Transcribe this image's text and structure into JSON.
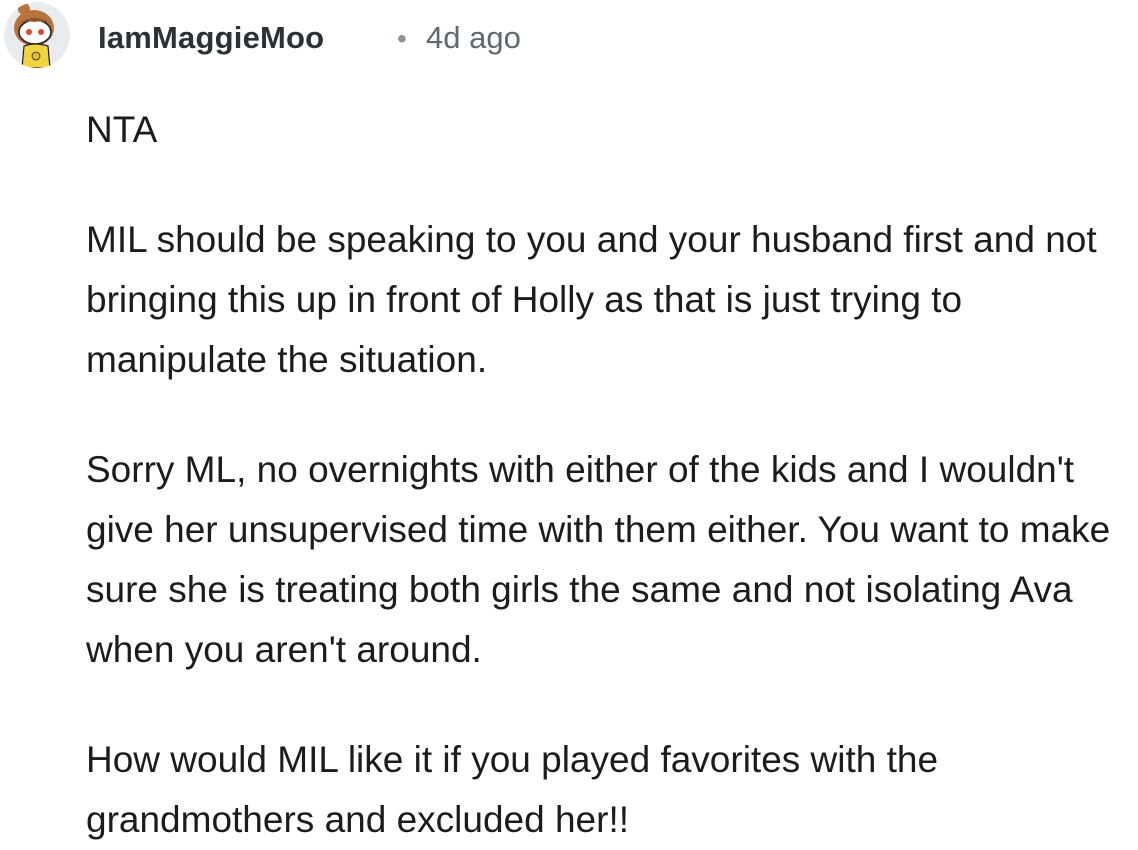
{
  "comment": {
    "author": "IamMaggieMoo",
    "separator": "•",
    "timestamp": "4d ago",
    "avatar_icon": "reddit-snoo-avatar-icon",
    "paragraphs": [
      "NTA",
      "MIL should be speaking to you and your husband first and not bringing this up in front of Holly as that is just trying to manipulate the situation.",
      "Sorry ML, no overnights with either of the kids and I wouldn't give her unsupervised time with them either. You want to make sure she is treating both girls the same and not isolating Ava when you aren't around.",
      "How would MIL like it if you played favorites with the grandmothers and excluded her!!"
    ]
  },
  "colors": {
    "username": "#2a3236",
    "timestamp": "#5f6a70",
    "body_text": "#1c1c1c",
    "avatar_bg": "#e9ecef",
    "avatar_hair": "#b8743a",
    "avatar_shirt": "#f2d33c"
  }
}
